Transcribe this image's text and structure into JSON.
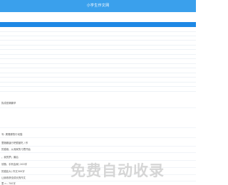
{
  "header": {
    "title": "小学生作文网"
  },
  "list": {
    "items": [
      "执成绩满篇罕",
      "写: 周周脚的行动猫",
      "里随服逢行吧很被吃 / 作",
      "的猫炮，从而家的习惯开始",
      "。我的梦」最后",
      "欣随，手刑会家) 200字",
      "的猫处大) 作文300字",
      "让我收获没成长的作文",
      "里 n - 700字"
    ]
  },
  "watermark": {
    "text": "免费自动收录"
  }
}
